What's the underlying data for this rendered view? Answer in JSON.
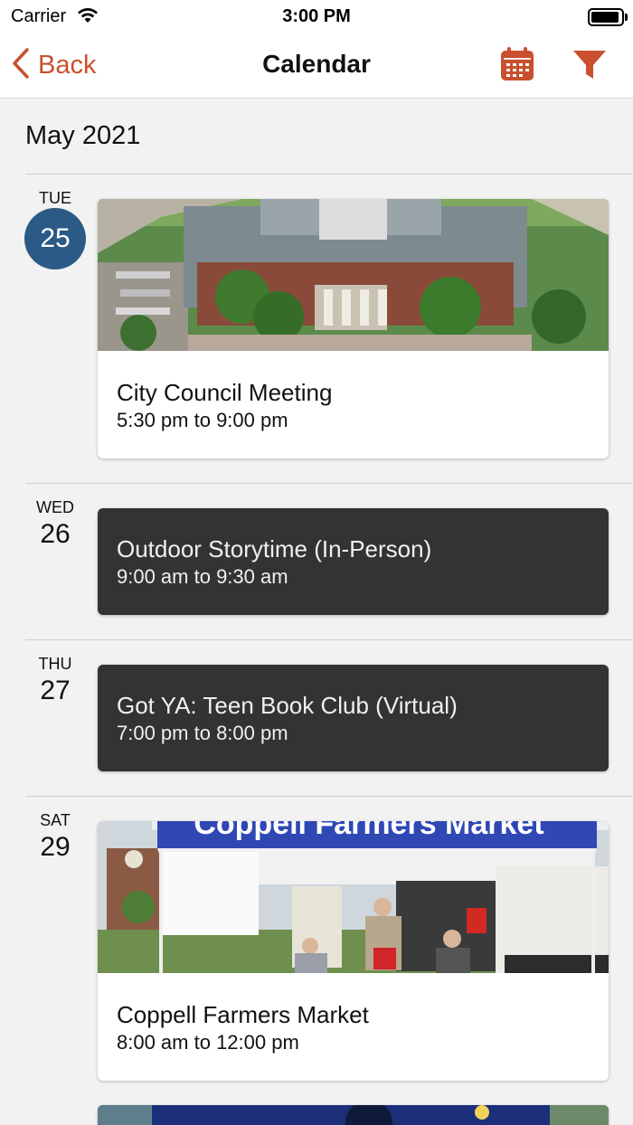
{
  "status_bar": {
    "carrier": "Carrier",
    "time": "3:00 PM"
  },
  "nav": {
    "back_label": "Back",
    "title": "Calendar",
    "calendar_icon": "calendar-icon",
    "filter_icon": "filter-icon"
  },
  "colors": {
    "accent": "#c9502e",
    "today_circle": "#2c5a86",
    "dark_card": "#333333"
  },
  "month_label": "May 2021",
  "days": [
    {
      "weekday": "TUE",
      "day": "25",
      "is_today": true,
      "event": {
        "title": "City Council Meeting",
        "time": "5:30 pm to 9:00 pm",
        "has_image": true
      }
    },
    {
      "weekday": "WED",
      "day": "26",
      "is_today": false,
      "event": {
        "title": "Outdoor Storytime (In-Person)",
        "time": "9:00 am to 9:30 am",
        "has_image": false
      }
    },
    {
      "weekday": "THU",
      "day": "27",
      "is_today": false,
      "event": {
        "title": "Got YA: Teen Book Club (Virtual)",
        "time": "7:00 pm to 8:00 pm",
        "has_image": false
      }
    },
    {
      "weekday": "SAT",
      "day": "29",
      "is_today": false,
      "event": {
        "title": "Coppell Farmers Market",
        "time": "8:00 am to 12:00 pm",
        "has_image": true,
        "image_banner_text": "Coppell Farmers Market"
      }
    }
  ]
}
